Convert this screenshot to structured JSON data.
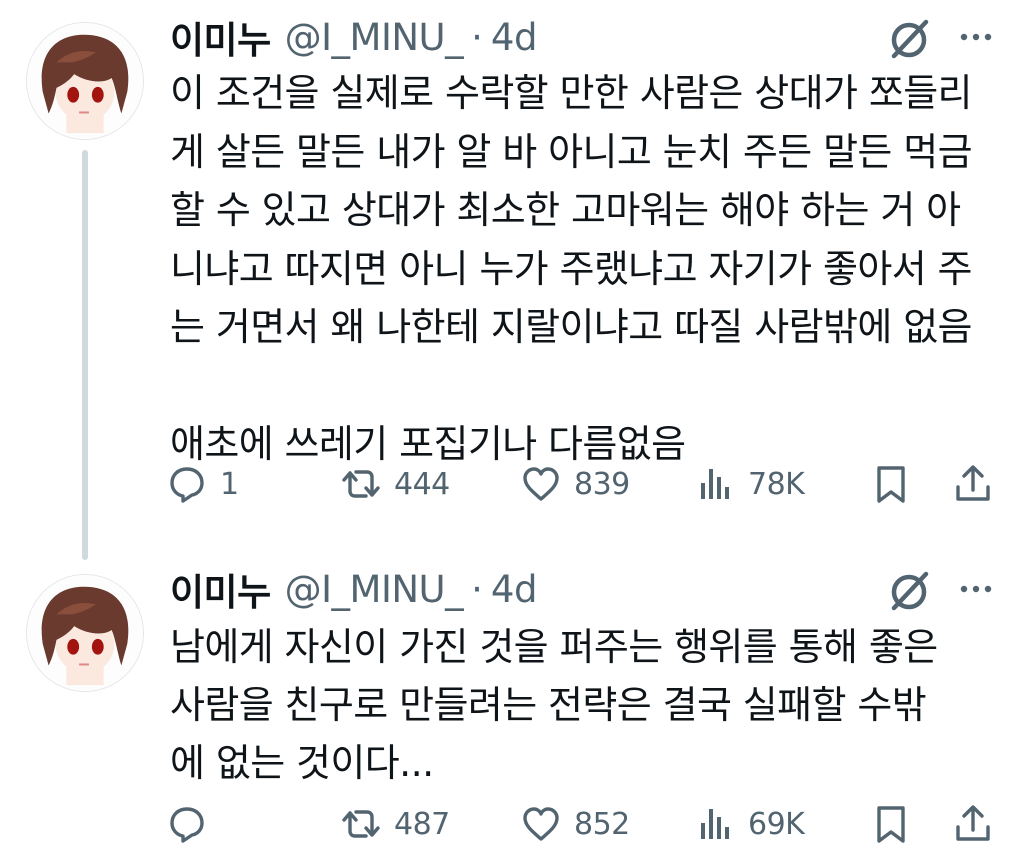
{
  "tweets": [
    {
      "author_name": "이미누",
      "handle": "@I_MINU_",
      "separator": "·",
      "time": "4d",
      "text": "이 조건을 실제로 수락할 만한 사람은 상대가 쪼들리\n게 살든 말든 내가 알 바 아니고 눈치 주든 말든 먹금\n할 수 있고 상대가 최소한 고마워는 해야 하는 거 아\n니냐고 따지면 아니 누가 주랬냐고 자기가 좋아서 주\n는 거면서 왜 나한테 지랄이냐고 따질 사람밖에 없음\n\n애초에 쓰레기 포집기나 다름없음",
      "replies": "1",
      "reposts": "444",
      "likes": "839",
      "views": "78K",
      "has_thread_line": true
    },
    {
      "author_name": "이미누",
      "handle": "@I_MINU_",
      "separator": "·",
      "time": "4d",
      "text": "남에게 자신이 가진 것을 퍼주는 행위를 통해 좋은\n사람을 친구로 만들려는 전략은 결국 실패할 수밖\n에 없는 것이다...",
      "replies": "",
      "reposts": "487",
      "likes": "852",
      "views": "69K",
      "has_thread_line": false
    }
  ],
  "icons": {
    "reply": "reply-icon",
    "repost": "repost-icon",
    "like": "heart-icon",
    "views": "views-icon",
    "bookmark": "bookmark-icon",
    "share": "share-icon",
    "grok": "grok-icon",
    "more": "more-icon"
  },
  "colors": {
    "text": "#0f1419",
    "secondary": "#536471",
    "thread_line": "#cfd9de",
    "background": "#ffffff"
  }
}
